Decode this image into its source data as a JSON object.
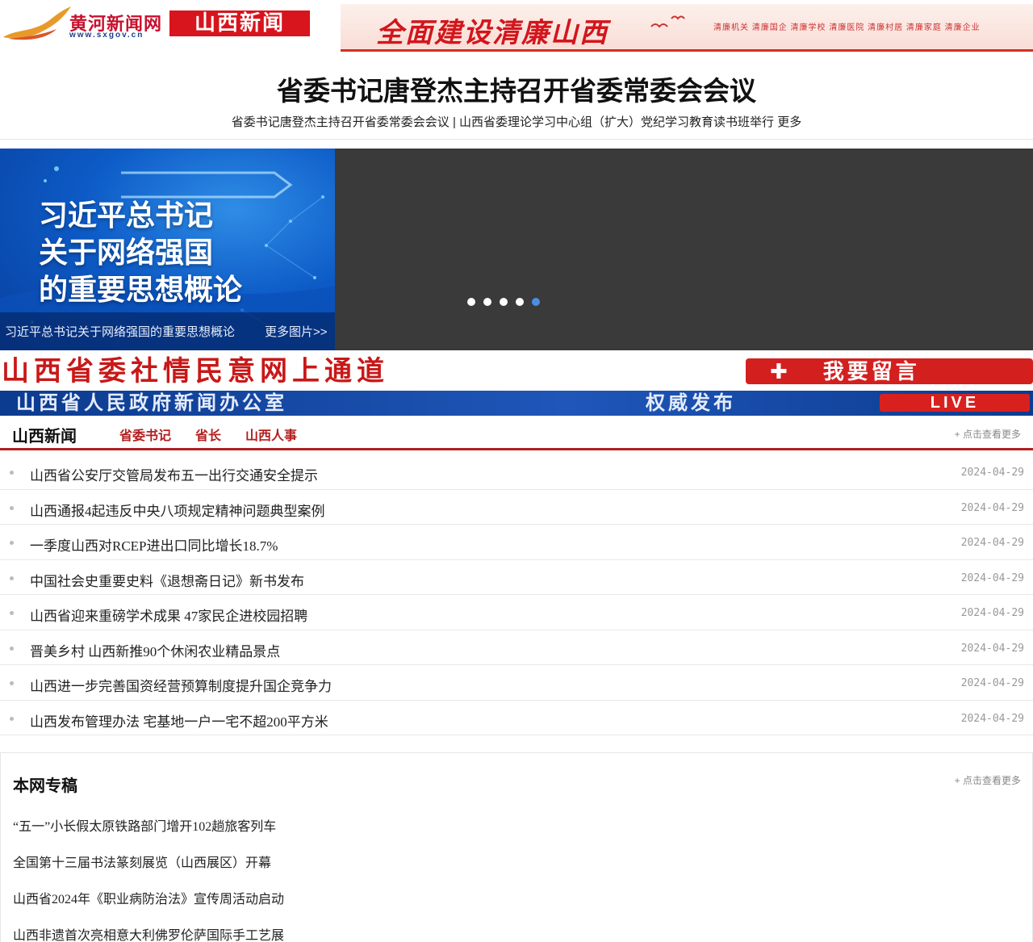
{
  "header": {
    "logo_cn": "黄河新闻网",
    "logo_url": "www.sxgov.cn",
    "logo_box": "山西新闻",
    "banner_title": "全面建设清廉山西",
    "banner_sub": "清廉机关 清廉国企 清廉学校 清廉医院 清廉村居 清廉家庭 清廉企业"
  },
  "headline": {
    "title": "省委书记唐登杰主持召开省委常委会会议",
    "sub_link1": "省委书记唐登杰主持召开省委常委会会议",
    "separator": " | ",
    "sub_link2": "山西省委理论学习中心组（扩大）党纪学习教育读书班举行",
    "more": "更多"
  },
  "slider": {
    "slide_line1": "习近平总书记",
    "slide_line2": "关于网络强国",
    "slide_line3": "的重要思想概论",
    "caption": "习近平总书记关于网络强国的重要思想概论",
    "more": "更多图片>>",
    "active_dot": 4
  },
  "banners": {
    "red_text": "山西省委社情民意网上通道",
    "red_button_plus": "✚",
    "red_button": "我要留言",
    "blue_text": "山西省人民政府新闻办公室",
    "blue_text2": "权威发布",
    "blue_live": "LIVE"
  },
  "news": {
    "title": "山西新闻",
    "tabs": [
      "省委书记",
      "省长",
      "山西人事"
    ],
    "more": "+ 点击查看更多",
    "items": [
      {
        "title": "山西省公安厅交管局发布五一出行交通安全提示",
        "date": "2024-04-29"
      },
      {
        "title": "山西通报4起违反中央八项规定精神问题典型案例",
        "date": "2024-04-29"
      },
      {
        "title": "一季度山西对RCEP进出口同比增长18.7%",
        "date": "2024-04-29"
      },
      {
        "title": "中国社会史重要史料《退想斋日记》新书发布",
        "date": "2024-04-29"
      },
      {
        "title": "山西省迎来重磅学术成果 47家民企进校园招聘",
        "date": "2024-04-29"
      },
      {
        "title": "晋美乡村 山西新推90个休闲农业精品景点",
        "date": "2024-04-29"
      },
      {
        "title": "山西进一步完善国资经营预算制度提升国企竞争力",
        "date": "2024-04-29"
      },
      {
        "title": "山西发布管理办法 宅基地一户一宅不超200平方米",
        "date": "2024-04-29"
      }
    ]
  },
  "special": {
    "title": "本网专稿",
    "more": "+ 点击查看更多",
    "items": [
      "“五一”小长假太原铁路部门增开102趟旅客列车",
      "全国第十三届书法篆刻展览（山西展区）开幕",
      "山西省2024年《职业病防治法》宣传周活动启动",
      "山西非遗首次亮相意大利佛罗伦萨国际手工艺展"
    ]
  },
  "colors": {
    "brand_red": "#b31e1e",
    "accent_blue": "#4a90e2"
  }
}
